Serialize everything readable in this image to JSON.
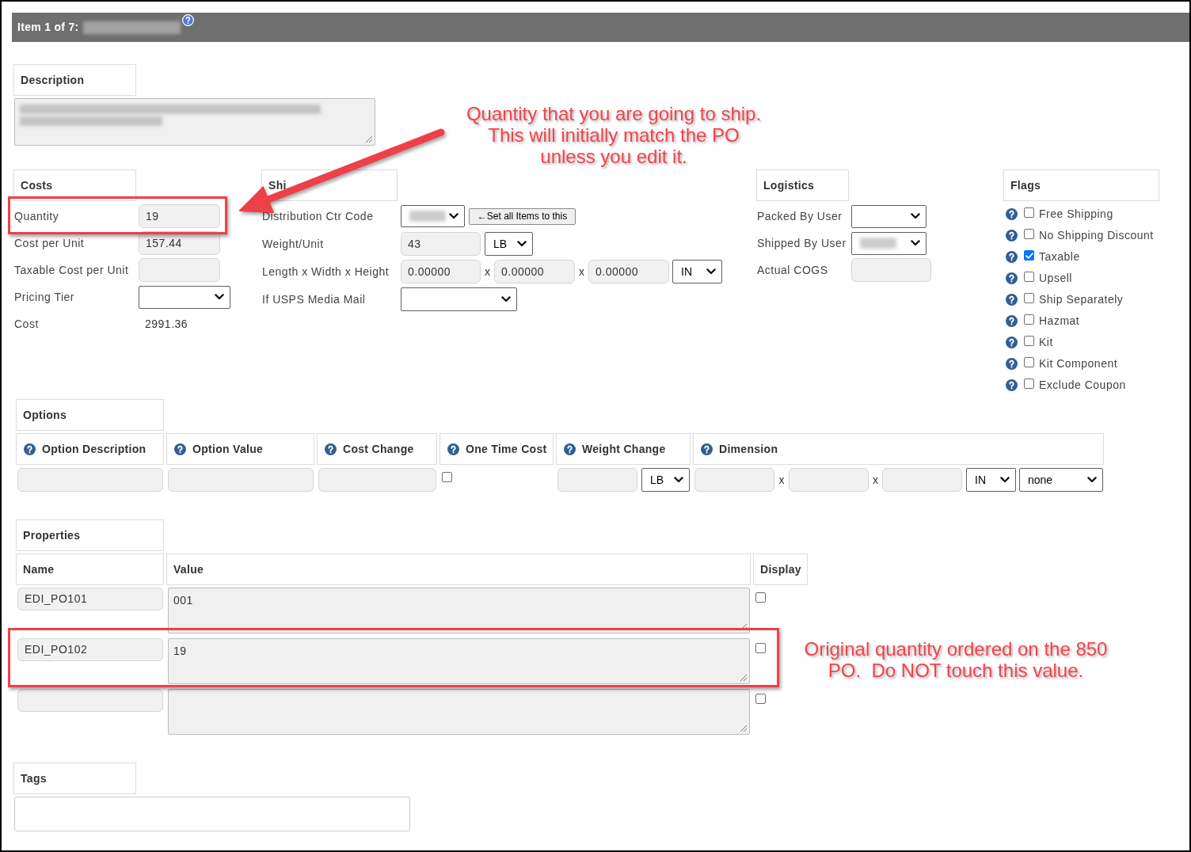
{
  "header": {
    "title": "Item 1 of 7:",
    "name_redacted": true
  },
  "description": {
    "heading": "Description",
    "redacted": true
  },
  "costs": {
    "heading": "Costs",
    "rows": [
      {
        "kind": "input",
        "label": "Quantity",
        "value": "19"
      },
      {
        "kind": "input",
        "label": "Cost per Unit",
        "value": "157.44"
      },
      {
        "kind": "input",
        "label": "Taxable Cost per Unit"
      },
      {
        "kind": "select",
        "label": "Pricing Tier"
      },
      {
        "kind": "text",
        "label": "Cost",
        "value": "2991.36"
      }
    ]
  },
  "shipping": {
    "heading": "Shi",
    "rows": [
      {
        "label": "Distribution Ctr Code",
        "controls": [
          {
            "kind": "select",
            "redacted": true
          },
          {
            "kind": "button",
            "label": "←Set all Items to this"
          }
        ]
      },
      {
        "label": "Weight/Unit",
        "controls": [
          {
            "kind": "input",
            "value": "43"
          },
          {
            "kind": "select",
            "value": "LB"
          }
        ]
      },
      {
        "label": "Length x Width x Height",
        "controls": [
          {
            "kind": "input",
            "value": "0.00000"
          },
          {
            "kind": "separator",
            "value": "x"
          },
          {
            "kind": "input",
            "value": "0.00000"
          },
          {
            "kind": "separator",
            "value": "x"
          },
          {
            "kind": "input",
            "value": "0.00000"
          },
          {
            "kind": "select",
            "value": "IN"
          }
        ]
      },
      {
        "label": "If USPS Media Mail",
        "controls": [
          {
            "kind": "select"
          }
        ]
      }
    ]
  },
  "logistics": {
    "heading": "Logistics",
    "rows": [
      {
        "kind": "select",
        "label": "Packed By User"
      },
      {
        "kind": "select",
        "label": "Shipped By User",
        "redacted": true
      },
      {
        "kind": "input",
        "label": "Actual COGS"
      }
    ]
  },
  "flags": {
    "heading": "Flags",
    "items": [
      {
        "label": "Free Shipping",
        "checked": false
      },
      {
        "label": "No Shipping Discount",
        "checked": false
      },
      {
        "label": "Taxable",
        "checked": true
      },
      {
        "label": "Upsell",
        "checked": false
      },
      {
        "label": "Ship Separately",
        "checked": false
      },
      {
        "label": "Hazmat",
        "checked": false
      },
      {
        "label": "Kit",
        "checked": false
      },
      {
        "label": "Kit Component",
        "checked": false
      },
      {
        "label": "Exclude Coupon",
        "checked": false
      }
    ]
  },
  "options": {
    "heading": "Options",
    "columns": [
      {
        "label": "Option Description"
      },
      {
        "label": "Option Value"
      },
      {
        "label": "Cost Change"
      },
      {
        "label": "One Time Cost"
      },
      {
        "label": "Weight Change"
      },
      {
        "label": "Dimension"
      }
    ],
    "entry_row": [
      {
        "controls": [
          {
            "kind": "input"
          }
        ]
      },
      {
        "controls": [
          {
            "kind": "input"
          }
        ]
      },
      {
        "controls": [
          {
            "kind": "input"
          }
        ]
      },
      {
        "controls": [
          {
            "kind": "checkbox",
            "checked": false
          }
        ]
      },
      {
        "controls": [
          {
            "kind": "input"
          },
          {
            "kind": "select",
            "value": "LB"
          }
        ]
      },
      {
        "controls": [
          {
            "kind": "input"
          },
          {
            "kind": "separator",
            "value": "x"
          },
          {
            "kind": "input"
          },
          {
            "kind": "separator",
            "value": "x"
          },
          {
            "kind": "input"
          },
          {
            "kind": "select",
            "value": "IN"
          },
          {
            "kind": "select",
            "value": "none"
          }
        ]
      }
    ]
  },
  "properties": {
    "heading": "Properties",
    "columns": [
      {
        "label": "Name"
      },
      {
        "label": "Value"
      },
      {
        "label": "Display"
      }
    ],
    "rows": [
      {
        "name": "EDI_PO101",
        "value": "001",
        "display": false
      },
      {
        "name": "EDI_PO102",
        "value": "19",
        "display": false
      },
      {
        "display": false
      }
    ]
  },
  "tags": {
    "heading": "Tags"
  },
  "notes": [
    {
      "lines": [
        "Quantity that you are going to ship.",
        "This will initially match the PO",
        "unless you edit it."
      ]
    },
    {
      "lines": [
        "Original quantity ordered on the 850",
        "PO.  Do NOT touch this value."
      ]
    }
  ]
}
